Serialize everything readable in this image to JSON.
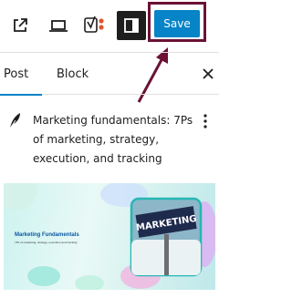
{
  "toolbar": {
    "save_label": "Save",
    "icons": [
      "external-link-icon",
      "laptop-icon",
      "yoast-icon",
      "sidebar-settings-icon"
    ],
    "colors": {
      "save": "#0784c7",
      "settings_bg": "#1e1e1e",
      "highlight": "#6b1236"
    }
  },
  "tabs": [
    {
      "label": "Post",
      "active": true
    },
    {
      "label": "Block",
      "active": false
    }
  ],
  "post": {
    "title": "Marketing fundamentals: 7Ps of marketing, strategy, execution, and tracking"
  },
  "featured_image": {
    "heading": "Marketing Fundamentals",
    "subtext": "7Ps of marketing, strategy, execution and tracking",
    "sign_text": "MARKETING"
  }
}
